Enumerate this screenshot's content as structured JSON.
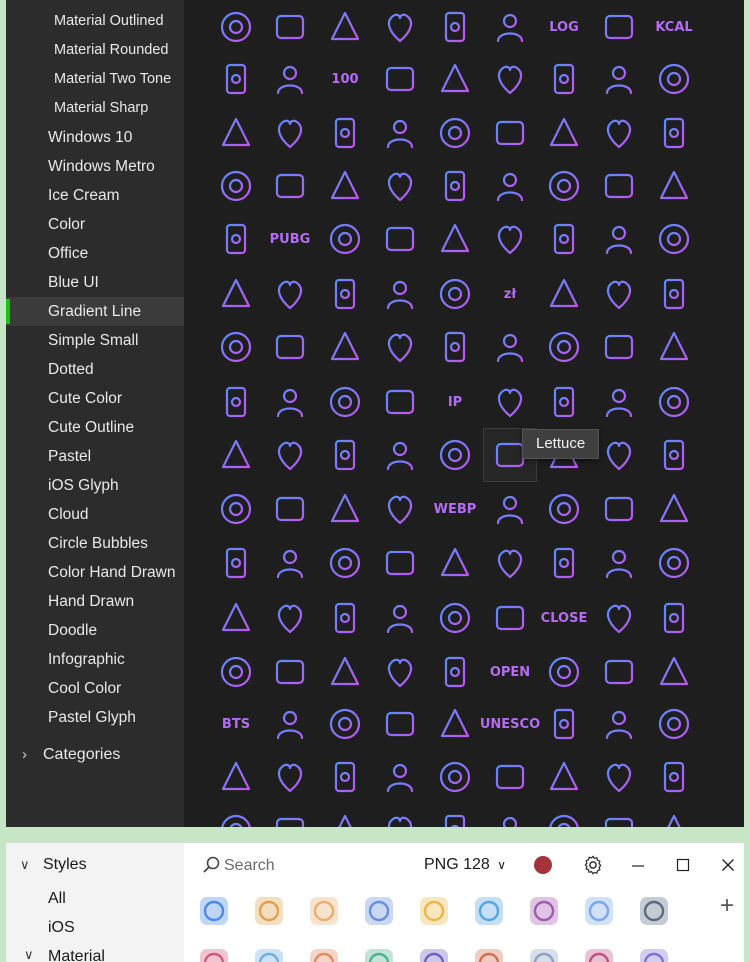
{
  "top_window": {
    "sidebar": {
      "sub_items": [
        {
          "label": "Material Outlined",
          "y": 7
        },
        {
          "label": "Material Rounded",
          "y": 36
        },
        {
          "label": "Material Two Tone",
          "y": 65
        },
        {
          "label": "Material Sharp",
          "y": 94
        }
      ],
      "items": [
        {
          "label": "Windows 10"
        },
        {
          "label": "Windows Metro"
        },
        {
          "label": "Ice Cream"
        },
        {
          "label": "Color"
        },
        {
          "label": "Office"
        },
        {
          "label": "Blue UI"
        },
        {
          "label": "Gradient Line",
          "selected": true
        },
        {
          "label": "Simple Small"
        },
        {
          "label": "Dotted"
        },
        {
          "label": "Cute Color"
        },
        {
          "label": "Cute Outline"
        },
        {
          "label": "Pastel"
        },
        {
          "label": "iOS Glyph"
        },
        {
          "label": "Cloud"
        },
        {
          "label": "Circle Bubbles"
        },
        {
          "label": "Color Hand Drawn"
        },
        {
          "label": "Hand Drawn"
        },
        {
          "label": "Doodle"
        },
        {
          "label": "Infographic"
        },
        {
          "label": "Cool Color"
        },
        {
          "label": "Pastel Glyph"
        }
      ],
      "categories": {
        "label": "Categories"
      }
    },
    "icon_grid": {
      "text_glyphs": {
        "log": "LOG",
        "kcal": "KCAL",
        "hundred": "100",
        "pubg": "PUBG",
        "zloty": "zł",
        "webp": "WEBP",
        "close_sign": "CLOSE",
        "open_sign": "OPEN",
        "bts": "BTS",
        "unesco": "UNESCO",
        "ip": "IP",
        "bts_small": "BTS"
      },
      "hover_tooltip": "Lettuce"
    },
    "colors": {
      "background": "#1e1e1e",
      "sidebar": "#2c2c2c",
      "selected_indicator": "#16c60c",
      "icon_start": "#5a8cff",
      "icon_end": "#c254f0"
    }
  },
  "bottom_window": {
    "sidebar": {
      "styles_label": "Styles",
      "items": [
        "All",
        "iOS",
        "Material"
      ]
    },
    "toolbar": {
      "search_placeholder": "Search",
      "format_label": "PNG 128",
      "color_value": "#a4343a"
    }
  }
}
